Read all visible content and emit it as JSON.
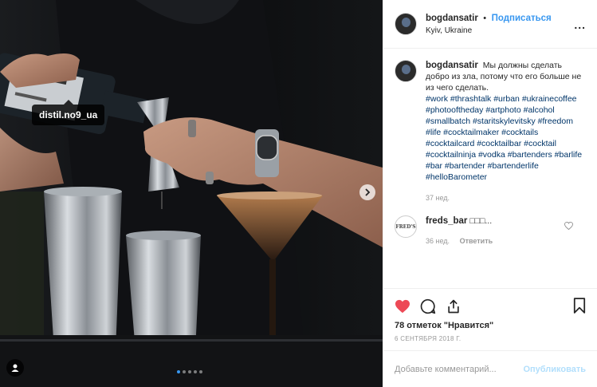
{
  "photo": {
    "tag_text": "distil.no9_ua",
    "carousel": {
      "slides": 5,
      "active": 1
    }
  },
  "header": {
    "username": "bogdansatir",
    "separator": "•",
    "follow_label": "Подписаться",
    "location": "Kyiv, Ukraine",
    "more_label": "..."
  },
  "caption": {
    "username": "bogdansatir",
    "text": "Мы должны сделать добро из зла, потому что его больше не из чего сделать.",
    "hashtags": "#work #thrashtalk #urban #ukrainecoffee #photooftheday #artphoto #alcohol #smallbatch #staritskylevitsky #freedom #life #cocktailmaker #cocktails #cocktailcard #cocktailbar #cocktail #cocktailninja #vodka #bartenders #barlife #bar #bartender #bartenderlife #helloBarometer",
    "age": "37 нед."
  },
  "comment": {
    "avatar_text": "FRED'S",
    "username": "freds_bar",
    "text": "□□□...",
    "age": "36 нед.",
    "reply_label": "Ответить"
  },
  "actions": {
    "likes": "78 отметок \"Нравится\"",
    "date": "6 СЕНТЯБРЯ 2018 Г."
  },
  "add_comment": {
    "placeholder": "Добавьте комментарий...",
    "publish_label": "Опубликовать"
  },
  "colors": {
    "accent": "#3897f0",
    "like": "#ed4956",
    "hashtag": "#003569"
  }
}
